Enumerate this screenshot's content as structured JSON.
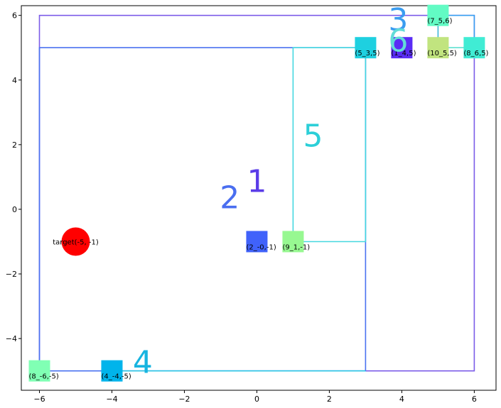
{
  "chart_data": {
    "type": "scatter",
    "xlim": [
      -6.5,
      6.6
    ],
    "ylim": [
      -5.6,
      6.3
    ],
    "xticks": [
      -6,
      -4,
      -2,
      0,
      2,
      4,
      6
    ],
    "yticks": [
      -4,
      -2,
      0,
      2,
      4,
      6
    ],
    "xtick_labels": [
      "−6",
      "−4",
      "−2",
      "0",
      "2",
      "4",
      "6"
    ],
    "ytick_labels": [
      "−4",
      "−2",
      "0",
      "2",
      "4",
      "6"
    ],
    "grid": false,
    "target": {
      "x": -5,
      "y": -1,
      "label": "target(-5, -1)",
      "color": "#ff0000"
    },
    "nodes": [
      {
        "id": "n1",
        "x": -6,
        "y": -5,
        "label": "(8_-6,-5)",
        "color": "#80ffb4"
      },
      {
        "id": "n2",
        "x": -4,
        "y": -5,
        "label": "(4_-4,-5)",
        "color": "#00b4eb"
      },
      {
        "id": "n3",
        "x": 0,
        "y": -1,
        "label": "(2_-0,-1)",
        "color": "#4062fa"
      },
      {
        "id": "n4",
        "x": 1,
        "y": -1,
        "label": "(9_1,-1)",
        "color": "#97f891"
      },
      {
        "id": "n5",
        "x": 3,
        "y": 5,
        "label": "(5_3,5)",
        "color": "#1ed0e0"
      },
      {
        "id": "n6",
        "x": 4,
        "y": 5,
        "label": "(1_4,5)",
        "color": "#5a2cf5"
      },
      {
        "id": "n7",
        "x": 5,
        "y": 6,
        "label": "(7_5,6)",
        "color": "#62fbc4"
      },
      {
        "id": "n8",
        "x": 5,
        "y": 5,
        "label": "(10_5,5)",
        "color": "#c1e47f"
      },
      {
        "id": "n9",
        "x": 6,
        "y": 5,
        "label": "(8_6,5)",
        "color": "#40ecd4"
      }
    ],
    "paths": [
      {
        "id": "route-1",
        "color": "#7c5ce8",
        "points": [
          [
            -6,
            -5
          ],
          [
            -6,
            6
          ],
          [
            6,
            6
          ],
          [
            6,
            -5
          ],
          [
            3,
            -5
          ]
        ]
      },
      {
        "id": "route-2",
        "color": "#4a72f0",
        "points": [
          [
            -6,
            -5
          ],
          [
            -6,
            5
          ],
          [
            3,
            5
          ],
          [
            3,
            -5
          ],
          [
            -6,
            -5
          ]
        ]
      },
      {
        "id": "route-3",
        "color": "#3aa0f0",
        "points": [
          [
            5,
            6
          ],
          [
            6,
            6
          ],
          [
            6,
            5
          ]
        ]
      },
      {
        "id": "route-4",
        "color": "#2cc6e6",
        "points": [
          [
            -4,
            -5
          ],
          [
            3,
            -5
          ]
        ]
      },
      {
        "id": "route-5",
        "color": "#45d8e0",
        "points": [
          [
            1,
            -1
          ],
          [
            1,
            5
          ],
          [
            3,
            5
          ],
          [
            3,
            -1
          ],
          [
            1,
            -1
          ]
        ]
      },
      {
        "id": "route-6",
        "color": "#5fe0d0",
        "points": [
          [
            5,
            5
          ],
          [
            6,
            5
          ]
        ]
      },
      {
        "id": "route-7",
        "color": "#3fb8d8",
        "points": [
          [
            5,
            6
          ],
          [
            5,
            5
          ]
        ]
      }
    ],
    "route_labels": [
      {
        "text": "1",
        "x": 0.0,
        "y": 0.8,
        "color": "#5a3ce8"
      },
      {
        "text": "2",
        "x": -0.75,
        "y": 0.3,
        "color": "#4a6ef0"
      },
      {
        "text": "3",
        "x": 3.9,
        "y": 5.8,
        "color": "#3a9cf0"
      },
      {
        "text": "4",
        "x": -3.15,
        "y": -4.8,
        "color": "#18b4e0"
      },
      {
        "text": "5",
        "x": 1.55,
        "y": 2.2,
        "color": "#2ccfd8"
      },
      {
        "text": "6",
        "x": 3.9,
        "y": 5.15,
        "color": "#62dcd8"
      }
    ]
  }
}
